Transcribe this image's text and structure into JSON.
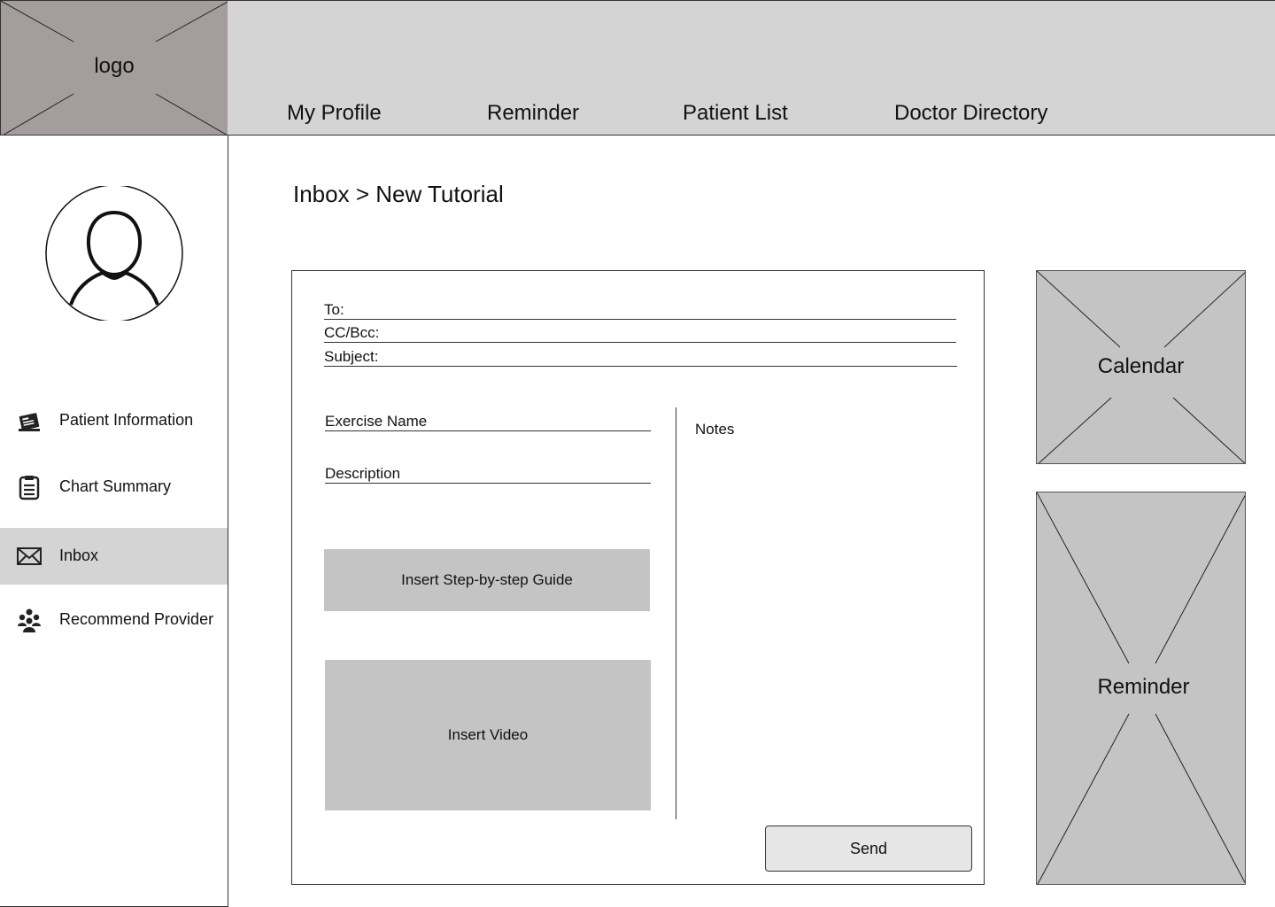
{
  "logo": {
    "text": "logo"
  },
  "nav": {
    "items": [
      {
        "label": "My Profile"
      },
      {
        "label": "Reminder"
      },
      {
        "label": "Patient List"
      },
      {
        "label": "Doctor Directory"
      }
    ]
  },
  "sidebar": {
    "items": [
      {
        "label": "Patient Information",
        "icon": "id-card-icon"
      },
      {
        "label": "Chart Summary",
        "icon": "clipboard-icon"
      },
      {
        "label": "Inbox",
        "icon": "envelope-icon",
        "active": true
      },
      {
        "label": "Recommend Provider",
        "icon": "group-icon"
      }
    ]
  },
  "breadcrumb": {
    "text": "Inbox > New Tutorial"
  },
  "composer": {
    "to_label": "To:",
    "cc_label": "CC/Bcc:",
    "subject_label": "Subject:",
    "exercise_label": "Exercise Name",
    "description_label": "Description",
    "guide_button": "Insert Step-by-step Guide",
    "video_button": "Insert Video",
    "notes_label": "Notes",
    "send_button": "Send"
  },
  "widgets": {
    "calendar": "Calendar",
    "reminder": "Reminder"
  },
  "colors": {
    "logo_bg": "#a39e9d",
    "topbar_bg": "#d4d4d4",
    "placeholder_gray": "#c4c4c4",
    "active_item_bg": "#d4d4d4",
    "send_bg": "#e6e6e6"
  }
}
